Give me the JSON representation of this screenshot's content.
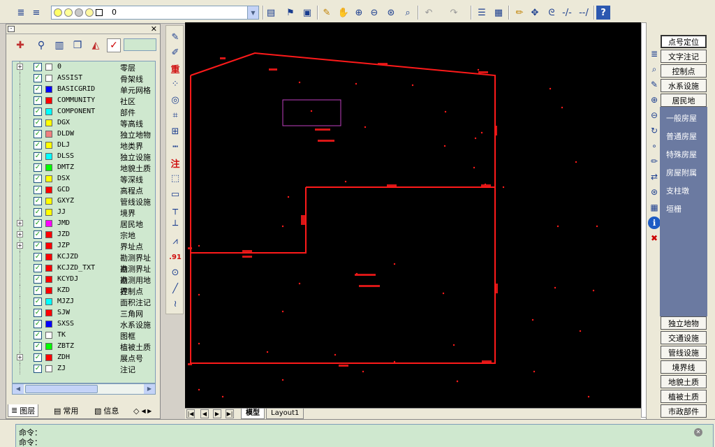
{
  "toolbar": {
    "layer_combo_value": "0",
    "icons": [
      "layers-icon",
      "layer-states-icon",
      "bulb-icon",
      "sun-icon",
      "freeze-icon",
      "lock-icon",
      "color-swatch-icon",
      "linetype-icon",
      "open-icon",
      "save-icon",
      "pencil-icon",
      "pan-icon",
      "zoom-realtime-icon",
      "zoom-window-icon",
      "zoom-extents-icon",
      "zoom-previous-icon",
      "undo-icon",
      "redo-icon",
      "properties-icon",
      "table-icon",
      "edit-icon",
      "move-icon",
      "snap-icon",
      "trim-icon",
      "extend-icon",
      "help-icon"
    ]
  },
  "layer_panel": {
    "tool_icons": [
      "new-layer-icon",
      "layer-filter-icon",
      "layer-manager-icon",
      "layer-copy-icon",
      "layer-paint-icon",
      "check-icon"
    ],
    "layers": [
      {
        "name": "0",
        "desc": "零层",
        "color": "#ffffff",
        "expandable": true
      },
      {
        "name": "ASSIST",
        "desc": "骨架线",
        "color": "#ffffff",
        "expandable": false
      },
      {
        "name": "BASICGRID",
        "desc": "单元网格",
        "color": "#0000ff",
        "expandable": false
      },
      {
        "name": "COMMUNITY",
        "desc": "社区",
        "color": "#ff0000",
        "expandable": false
      },
      {
        "name": "COMPONENT",
        "desc": "部件",
        "color": "#00ffff",
        "expandable": false
      },
      {
        "name": "DGX",
        "desc": "等高线",
        "color": "#ffff00",
        "expandable": false
      },
      {
        "name": "DLDW",
        "desc": "独立地物",
        "color": "#f08080",
        "expandable": false
      },
      {
        "name": "DLJ",
        "desc": "地类界",
        "color": "#ffff00",
        "expandable": false
      },
      {
        "name": "DLSS",
        "desc": "独立设施",
        "color": "#00ffff",
        "expandable": false
      },
      {
        "name": "DMTZ",
        "desc": "地貌土质",
        "color": "#00ff00",
        "expandable": false
      },
      {
        "name": "DSX",
        "desc": "等深线",
        "color": "#ffff00",
        "expandable": false
      },
      {
        "name": "GCD",
        "desc": "高程点",
        "color": "#ff0000",
        "expandable": false
      },
      {
        "name": "GXYZ",
        "desc": "管线设施",
        "color": "#ffff00",
        "expandable": false
      },
      {
        "name": "JJ",
        "desc": "境界",
        "color": "#ffff00",
        "expandable": false
      },
      {
        "name": "JMD",
        "desc": "居民地",
        "color": "#ff00ff",
        "expandable": true
      },
      {
        "name": "JZD",
        "desc": "宗地",
        "color": "#ff0000",
        "expandable": true
      },
      {
        "name": "JZP",
        "desc": "界址点",
        "color": "#ff0000",
        "expandable": true
      },
      {
        "name": "KCJZD",
        "desc": "勘测界址点",
        "color": "#ff0000",
        "expandable": false
      },
      {
        "name": "KCJZD_TXT",
        "desc": "勘测界址点",
        "color": "#ff0000",
        "expandable": false
      },
      {
        "name": "KCYDJ",
        "desc": "勘测用地界",
        "color": "#ff0000",
        "expandable": false
      },
      {
        "name": "KZD",
        "desc": "控制点",
        "color": "#ff0000",
        "expandable": false
      },
      {
        "name": "MJZJ",
        "desc": "面积注记",
        "color": "#00ffff",
        "expandable": false
      },
      {
        "name": "SJW",
        "desc": "三角网",
        "color": "#ff0000",
        "expandable": false
      },
      {
        "name": "SXSS",
        "desc": "水系设施",
        "color": "#0000ff",
        "expandable": false
      },
      {
        "name": "TK",
        "desc": "图框",
        "color": "#ffffff",
        "expandable": false
      },
      {
        "name": "ZBTZ",
        "desc": "植被土质",
        "color": "#00ff00",
        "expandable": false
      },
      {
        "name": "ZDH",
        "desc": "展点号",
        "color": "#ff0000",
        "expandable": true
      },
      {
        "name": "ZJ",
        "desc": "注记",
        "color": "#ffffff",
        "expandable": false
      }
    ],
    "tabs": [
      {
        "label": "图层",
        "icon": "layers-icon",
        "active": true
      },
      {
        "label": "常用",
        "icon": "document-icon",
        "active": false
      },
      {
        "label": "信息",
        "icon": "info-page-icon",
        "active": false
      },
      {
        "label": "",
        "icon": "tag-icon",
        "active": false
      }
    ]
  },
  "draw_tools": {
    "items": [
      {
        "icon": "point-icon",
        "glyph": "✎"
      },
      {
        "icon": "edit-point-icon",
        "glyph": "✐"
      },
      {
        "icon": "heavy-icon",
        "glyph": "重"
      },
      {
        "icon": "grid-points-icon",
        "glyph": "⁘"
      },
      {
        "icon": "camera-icon",
        "glyph": "◎"
      },
      {
        "icon": "parallel-icon",
        "glyph": "⌗"
      },
      {
        "icon": "map-icon",
        "glyph": "⊞"
      },
      {
        "icon": "dashed-line-icon",
        "glyph": "┅"
      },
      {
        "icon": "annotation-icon",
        "glyph": "注"
      },
      {
        "icon": "polygon-icon",
        "glyph": "⬚"
      },
      {
        "icon": "rectangle-icon",
        "glyph": "▭"
      },
      {
        "icon": "fence-icon",
        "glyph": "┬"
      },
      {
        "icon": "ditch-icon",
        "glyph": "┴"
      },
      {
        "icon": "bridge-icon",
        "glyph": "⩘"
      },
      {
        "icon": "elevation-icon",
        "glyph": ".91"
      },
      {
        "icon": "circle-icon",
        "glyph": "⊙"
      },
      {
        "icon": "line-icon",
        "glyph": "╱"
      },
      {
        "icon": "curve-icon",
        "glyph": "≀"
      }
    ]
  },
  "layout_tabs": {
    "tabs": [
      {
        "label": "模型",
        "active": true
      },
      {
        "label": "Layout1",
        "active": false
      }
    ]
  },
  "right_panel": {
    "top_buttons": [
      {
        "label": "点号定位",
        "selected": true
      },
      {
        "label": "文字注记",
        "selected": false
      },
      {
        "label": "控制点",
        "selected": false
      },
      {
        "label": "水系设施",
        "selected": false
      },
      {
        "label": "居民地",
        "selected": false
      }
    ],
    "panel_items": [
      "一般房屋",
      "普通房屋",
      "特殊房屋",
      "房屋附属",
      "支柱墩",
      "垣栅"
    ],
    "bottom_buttons": [
      "独立地物",
      "交通设施",
      "管线设施",
      "境界线",
      "地貌土质",
      "植被土质",
      "市政部件"
    ],
    "tool_icons": [
      "layers-icon",
      "query-icon",
      "edit-icon",
      "zoom-icon",
      "zoom-out-icon",
      "rotate-icon",
      "nodes-icon",
      "paint-icon",
      "link-icon",
      "globe-icon",
      "table-icon",
      "info-icon",
      "delete-icon"
    ]
  },
  "command": {
    "lines": [
      "命令：",
      "命令："
    ]
  },
  "colors": {
    "canvas_bg": "#000000",
    "drawing_line": "#ff1a1a",
    "selection_box": "#c040c0",
    "panel_bg": "#cfe8cf",
    "right_panel_accent": "#6b7aa1"
  }
}
